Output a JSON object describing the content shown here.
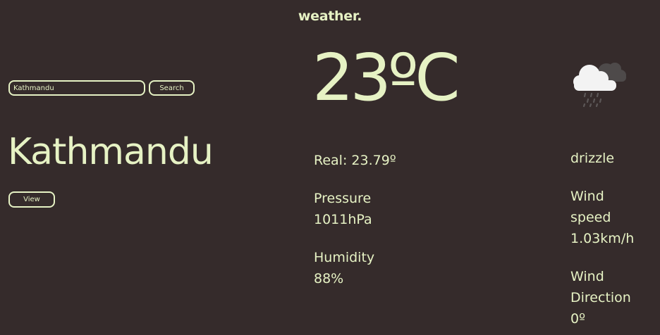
{
  "header": {
    "title": "weather."
  },
  "search": {
    "value": "Kathmandu",
    "button_label": "Search"
  },
  "location": {
    "city": "Kathmandu",
    "view_label": "View"
  },
  "current": {
    "temperature": "23ºC",
    "real_feel": "Real: 23.79º",
    "pressure_label": "Pressure",
    "pressure_value": "1011hPa",
    "humidity_label": "Humidity",
    "humidity_value": "88%",
    "description": "drizzle",
    "wind_speed_label_1": "Wind",
    "wind_speed_label_2": "speed",
    "wind_speed_value": "1.03km/h",
    "wind_direction_label_1": "Wind",
    "wind_direction_label_2": "Direction",
    "wind_direction_value": "0º",
    "icon": "rain-cloud-icon"
  },
  "colors": {
    "background": "#352b2b",
    "accent": "#e6f2c4"
  }
}
